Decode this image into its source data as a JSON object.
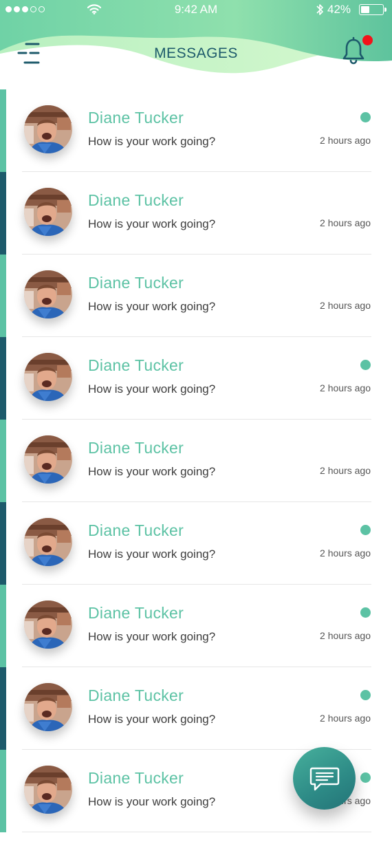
{
  "status_bar": {
    "time": "9:42 AM",
    "battery_percent": "42%",
    "battery_level": 0.42,
    "signal_icon": "signal-dots-icon",
    "wifi_icon": "wifi-icon",
    "bluetooth_icon": "bluetooth-icon"
  },
  "header": {
    "title": "MESSAGES",
    "menu_icon": "menu-icon",
    "notification_icon": "bell-icon",
    "has_notification": true
  },
  "colors": {
    "accent": "#5cc2a4",
    "dark_stripe": "#1d5a6b",
    "title": "#1d5a6b",
    "notification_dot": "#f2131a"
  },
  "messages": [
    {
      "name": "Diane Tucker",
      "preview": "How is your work going?",
      "time": "2 hours ago",
      "unread": true,
      "stripe": "light"
    },
    {
      "name": "Diane Tucker",
      "preview": "How is your work going?",
      "time": "2 hours ago",
      "unread": false,
      "stripe": "dark"
    },
    {
      "name": "Diane Tucker",
      "preview": "How is your work going?",
      "time": "2 hours ago",
      "unread": false,
      "stripe": "light"
    },
    {
      "name": "Diane Tucker",
      "preview": "How is your work going?",
      "time": "2 hours ago",
      "unread": true,
      "stripe": "dark"
    },
    {
      "name": "Diane Tucker",
      "preview": "How is your work going?",
      "time": "2 hours ago",
      "unread": false,
      "stripe": "light"
    },
    {
      "name": "Diane Tucker",
      "preview": "How is your work going?",
      "time": "2 hours ago",
      "unread": true,
      "stripe": "dark"
    },
    {
      "name": "Diane Tucker",
      "preview": "How is your work going?",
      "time": "2 hours ago",
      "unread": true,
      "stripe": "light"
    },
    {
      "name": "Diane Tucker",
      "preview": "How is your work going?",
      "time": "2 hours ago",
      "unread": true,
      "stripe": "dark"
    },
    {
      "name": "Diane Tucker",
      "preview": "How is your work going?",
      "time": "2 hours ago",
      "unread": true,
      "stripe": "light"
    }
  ],
  "fab": {
    "icon": "chat-icon"
  }
}
